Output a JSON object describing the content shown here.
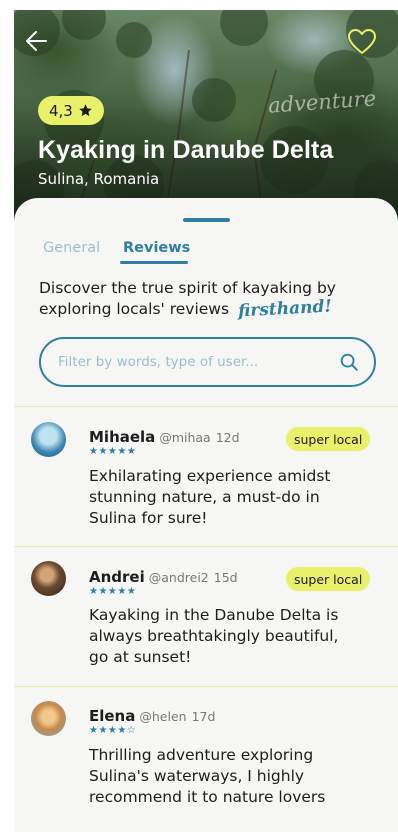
{
  "hero": {
    "title": "Kyaking in Danube Delta",
    "location": "Sulina, Romania",
    "rating": "4,3",
    "watermark": "adventure"
  },
  "tabs": [
    {
      "label": "General",
      "active": false
    },
    {
      "label": "Reviews",
      "active": true
    }
  ],
  "intro": {
    "line1": "Discover the true spirit of kayaking by",
    "line2": "exploring locals' reviews",
    "highlight": "firsthand!"
  },
  "search": {
    "placeholder": "Filter by words, type of user..."
  },
  "reviews": [
    {
      "name": "Mihaela",
      "handle": "@mihaa",
      "time": "12d",
      "rating": 5,
      "badge": "super local",
      "text_lines": [
        "Exhilarating experience amidst",
        "stunning nature, a must-do in",
        "Sulina for sure!"
      ]
    },
    {
      "name": "Andrei",
      "handle": "@andrei2",
      "time": "15d",
      "rating": 5,
      "badge": "super local",
      "text_lines": [
        "Kayaking in the Danube Delta is",
        "always breathtakingly beautiful,",
        "go at sunset!"
      ]
    },
    {
      "name": "Elena",
      "handle": "@helen",
      "time": "17d",
      "rating": 4,
      "badge": "",
      "text_lines": [
        "Thrilling adventure exploring",
        "Sulina's waterways, I highly",
        "recommend it to nature lovers"
      ]
    }
  ],
  "colors": {
    "accent": "#2f7fa2",
    "badge": "#e9f06a",
    "background": "#f6f7f5"
  },
  "icons": [
    "back-arrow-icon",
    "heart-icon",
    "star-icon",
    "search-icon"
  ]
}
